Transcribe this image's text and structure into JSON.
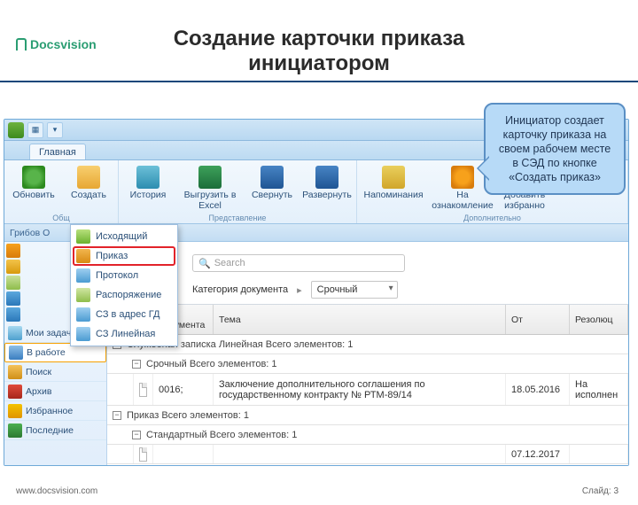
{
  "brand": "Docsvision",
  "slide_title_l1": "Создание карточки приказа",
  "slide_title_l2": "инициатором",
  "footer_url": "www.docsvision.com",
  "footer_slide_label": "Слайд:",
  "footer_slide_num": "3",
  "callout_text": "Инициатор создает карточку приказа на своем рабочем месте в СЭД по кнопке «Создать приказ»",
  "ribbon": {
    "tab": "Главная",
    "groups": {
      "g1": "Общ",
      "g2": "Представление",
      "g3": "Дополнительно"
    },
    "buttons": {
      "refresh": "Обновить",
      "create": "Создать",
      "history": "История",
      "export": "Выгрузить в Excel",
      "collapse": "Свернуть",
      "expand": "Развернуть",
      "remind": "Напоминания",
      "ack_l1": "На",
      "ack_l2": "ознакомление",
      "fav_l1": "Добавить",
      "fav_l2": "избранно"
    }
  },
  "infobar": "Грибов О",
  "create_menu": {
    "outgoing": "Исходящий",
    "order": "Приказ",
    "protocol": "Протокол",
    "rasporyazh": "Распоряжение",
    "sz_gd": "СЗ в адрес ГД",
    "sz_line": "СЗ Линейная"
  },
  "nav": {
    "my_tasks": "Мои задачи",
    "in_work": "В работе",
    "search": "Поиск",
    "archive": "Архив",
    "favorites": "Избранное",
    "recent": "Последние"
  },
  "search_placeholder": "Search",
  "filter_label": "Категория документа",
  "filter_value": "Срочный",
  "columns": {
    "num": "№ Документа",
    "subject": "Тема",
    "from": "От",
    "res": "Резолюц"
  },
  "groups": {
    "g1": "Служебная записка Линейная   Всего элементов: 1",
    "g1a": "Срочный   Всего элементов: 1",
    "g2": "Приказ   Всего элементов: 1",
    "g2a": "Стандартный   Всего элементов: 1"
  },
  "rows": {
    "r1": {
      "num": "0016;",
      "subject": "Заключение дополнительного соглашения по государственному контракту № РТМ-89/14",
      "from": "18.05.2016",
      "res": "На исполнен"
    },
    "r2": {
      "num": "",
      "subject": "",
      "from": "07.12.2017",
      "res": ""
    }
  }
}
